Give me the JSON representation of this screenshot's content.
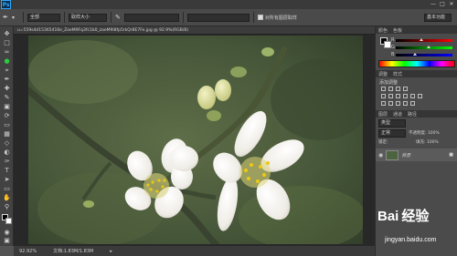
{
  "app": {
    "logo": "Ps"
  },
  "window": {
    "minimize": "—",
    "maximize": "□",
    "close": "✕"
  },
  "options": {
    "mode_value": "全部",
    "sample_field": "取样大小",
    "checkbox_label": "对所有图层取样",
    "workspace": "基本功能"
  },
  "document": {
    "tab_title": "u=559s4d15365416e_ZaeM9Fq3fc1b0_zaeM9l8fp5rkQr8E7Fe.jpg @ 92.9%(RGB/8)",
    "zoom": "92.92%",
    "doc_info": "文档:1.83M/1.83M"
  },
  "panels": {
    "color_tabs": [
      "颜色",
      "色板"
    ],
    "channels": [
      {
        "letter": "R",
        "value": 0.42,
        "gradient": "#000000,#ff0000"
      },
      {
        "letter": "G",
        "value": 0.55,
        "gradient": "#000000,#00ff00"
      },
      {
        "letter": "B",
        "value": 0.3,
        "gradient": "#000000,#0000ff"
      }
    ],
    "adjust_tabs": [
      "调整",
      "样式"
    ],
    "adjust_title": "添加调整",
    "layers_tabs": [
      "图层",
      "通道",
      "路径"
    ],
    "layers_filter": "类型",
    "blend_mode": "正常",
    "opacity": "不透明度: 100%",
    "lock_label": "锁定:",
    "fill": "填充: 100%",
    "layer_name": "背景"
  },
  "watermark": {
    "brand": "Bai 经验",
    "url": "jingyan.baidu.com"
  },
  "colors": {
    "ui_dark": "#282828",
    "panel_bg": "#4b4b4b",
    "accent_blue": "#31a8ff",
    "foreground_color": "#000000",
    "background_color": "#ffffff"
  }
}
